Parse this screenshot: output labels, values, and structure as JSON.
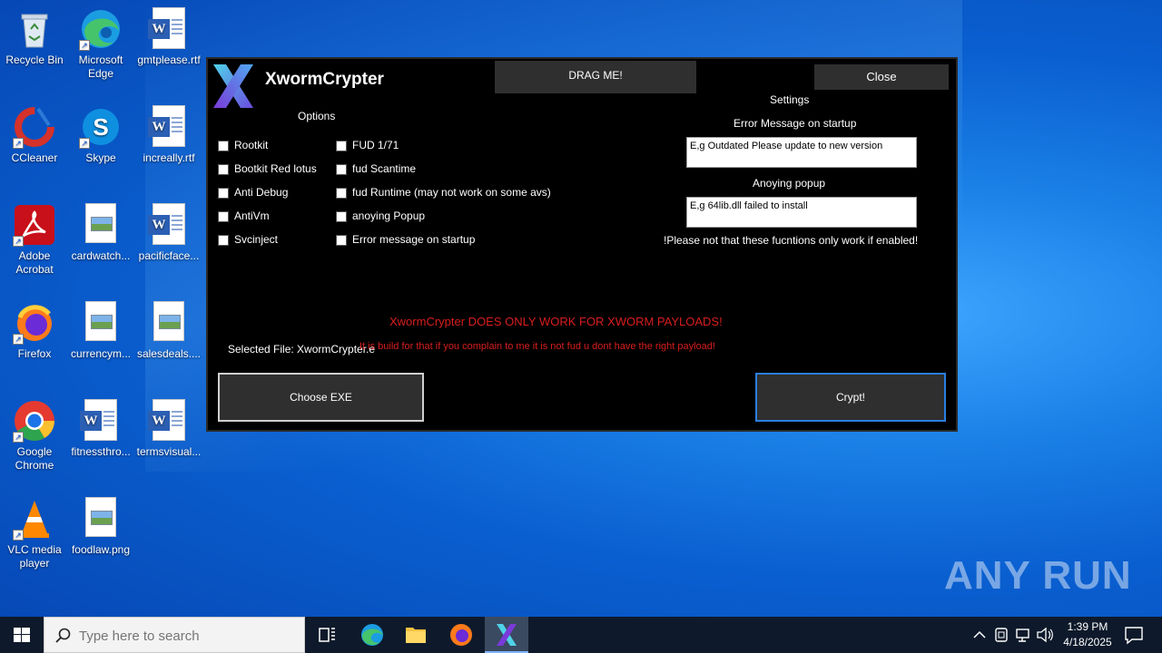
{
  "desktop": {
    "icons": [
      {
        "label": "Recycle Bin",
        "icon": "recycle-bin-icon"
      },
      {
        "label": "Microsoft Edge",
        "icon": "edge-icon"
      },
      {
        "label": "gmtplease.rtf",
        "icon": "word-doc-icon"
      },
      {
        "label": "CCleaner",
        "icon": "ccleaner-icon"
      },
      {
        "label": "Skype",
        "icon": "skype-icon"
      },
      {
        "label": "increally.rtf",
        "icon": "word-doc-icon"
      },
      {
        "label": "Adobe Acrobat",
        "icon": "acrobat-icon"
      },
      {
        "label": "cardwatch...",
        "icon": "image-file-icon"
      },
      {
        "label": "pacificface...",
        "icon": "word-doc-icon"
      },
      {
        "label": "Firefox",
        "icon": "firefox-icon"
      },
      {
        "label": "currencym...",
        "icon": "image-file-icon"
      },
      {
        "label": "salesdeals....",
        "icon": "image-file-icon"
      },
      {
        "label": "Google Chrome",
        "icon": "chrome-icon"
      },
      {
        "label": "fitnessthro...",
        "icon": "word-doc-icon"
      },
      {
        "label": "termsvisual...",
        "icon": "word-doc-icon"
      },
      {
        "label": "VLC media player",
        "icon": "vlc-icon"
      },
      {
        "label": "foodlaw.png",
        "icon": "image-file-icon"
      }
    ]
  },
  "app": {
    "title": "XwormCrypter",
    "drag_label": "DRAG ME!",
    "close_label": "Close",
    "options_heading": "Options",
    "options_left": [
      "Rootkit",
      "Bootkit Red lotus",
      "Anti Debug",
      "AntiVm",
      "Svcinject"
    ],
    "options_right": [
      "FUD 1/71",
      "fud Scantime",
      "fud Runtime (may not work on some avs)",
      "anoying Popup",
      "Error message on startup"
    ],
    "settings_heading": "Settings",
    "error_msg_label": "Error Message on startup",
    "error_msg_value": "E,g Outdated Please update to new version",
    "popup_label": "Anoying popup",
    "popup_value": "E,g 64lib.dll failed to install",
    "settings_note": "!Please not that these fucntions only work if enabled!",
    "warning_1": "XwormCrypter DOES ONLY WORK FOR XWORM PAYLOADS!",
    "selected_file": "Selected File: XwormCrypter.e",
    "warning_2": "It is build for that if you complain to me it is not fud u dont have the right payload!",
    "choose_exe_label": "Choose EXE",
    "crypt_label": "Crypt!"
  },
  "watermark": "ANY RUN",
  "taskbar": {
    "search_placeholder": "Type here to search",
    "time": "1:39 PM",
    "date": "4/18/2025"
  }
}
